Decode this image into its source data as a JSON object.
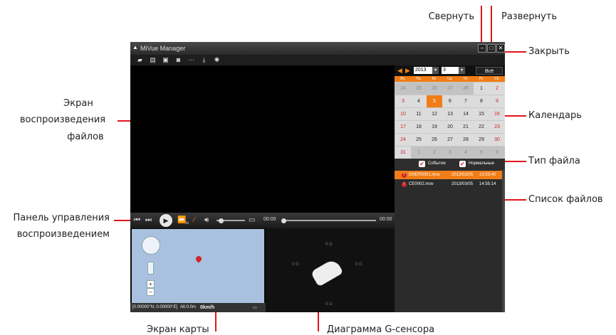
{
  "annotations": {
    "minimize": "Свернуть",
    "maximize": "Развернуть",
    "close": "Закрыть",
    "player_screen": [
      "Экран",
      "воспроизведения",
      "файлов"
    ],
    "calendar": "Календарь",
    "file_type": "Тип файла",
    "file_list": "Список файлов",
    "playback_panel": [
      "Панель управления",
      "воспроизведением"
    ],
    "map_screen": "Экран карты",
    "gsensor": "Диаграмма G-сенсора"
  },
  "app": {
    "title": "MiVue Manager",
    "toolbar_icons": [
      "open-folder-icon",
      "print-icon",
      "save-icon",
      "snapshot-icon",
      "split-icon",
      "download-icon",
      "settings-icon"
    ]
  },
  "controls": {
    "time_current": "00:00",
    "time_total": "00:00",
    "speed": "1x"
  },
  "map": {
    "coords": "[0.00000°N, 0.00000°E]",
    "alt": "Alt.0.0m",
    "speed": "0km/h"
  },
  "gsensor": {
    "value_label": "0 G"
  },
  "calendar": {
    "year": "2013",
    "month": "3",
    "all_label": "Всё",
    "day_names": [
      "Вс.",
      "Пн.",
      "Вт.",
      "Ср.",
      "Чт.",
      "Пт.",
      "Сб."
    ],
    "weeks": [
      [
        "24",
        "25",
        "26",
        "27",
        "28",
        "1",
        "2"
      ],
      [
        "3",
        "4",
        "5",
        "6",
        "7",
        "8",
        "9"
      ],
      [
        "10",
        "11",
        "12",
        "13",
        "14",
        "15",
        "16"
      ],
      [
        "17",
        "18",
        "19",
        "20",
        "21",
        "22",
        "23"
      ],
      [
        "24",
        "25",
        "26",
        "27",
        "28",
        "29",
        "30"
      ],
      [
        "31",
        "1",
        "2",
        "3",
        "4",
        "5",
        "6"
      ]
    ],
    "selected_day": "5"
  },
  "file_type": {
    "event_label": "Событие",
    "normal_label": "Нормальные"
  },
  "files": [
    {
      "name": "EMER0001.mov",
      "date": "2013/03/05",
      "time": "13:53:40",
      "selected": true
    },
    {
      "name": "CE0002.mov",
      "date": "2013/03/05",
      "time": "14:55:14",
      "selected": false
    }
  ],
  "colors": {
    "accent": "#f07d18",
    "callout_red": "#e0151d",
    "weekend_red": "#d2242a",
    "map_blue": "#a9c1de"
  }
}
